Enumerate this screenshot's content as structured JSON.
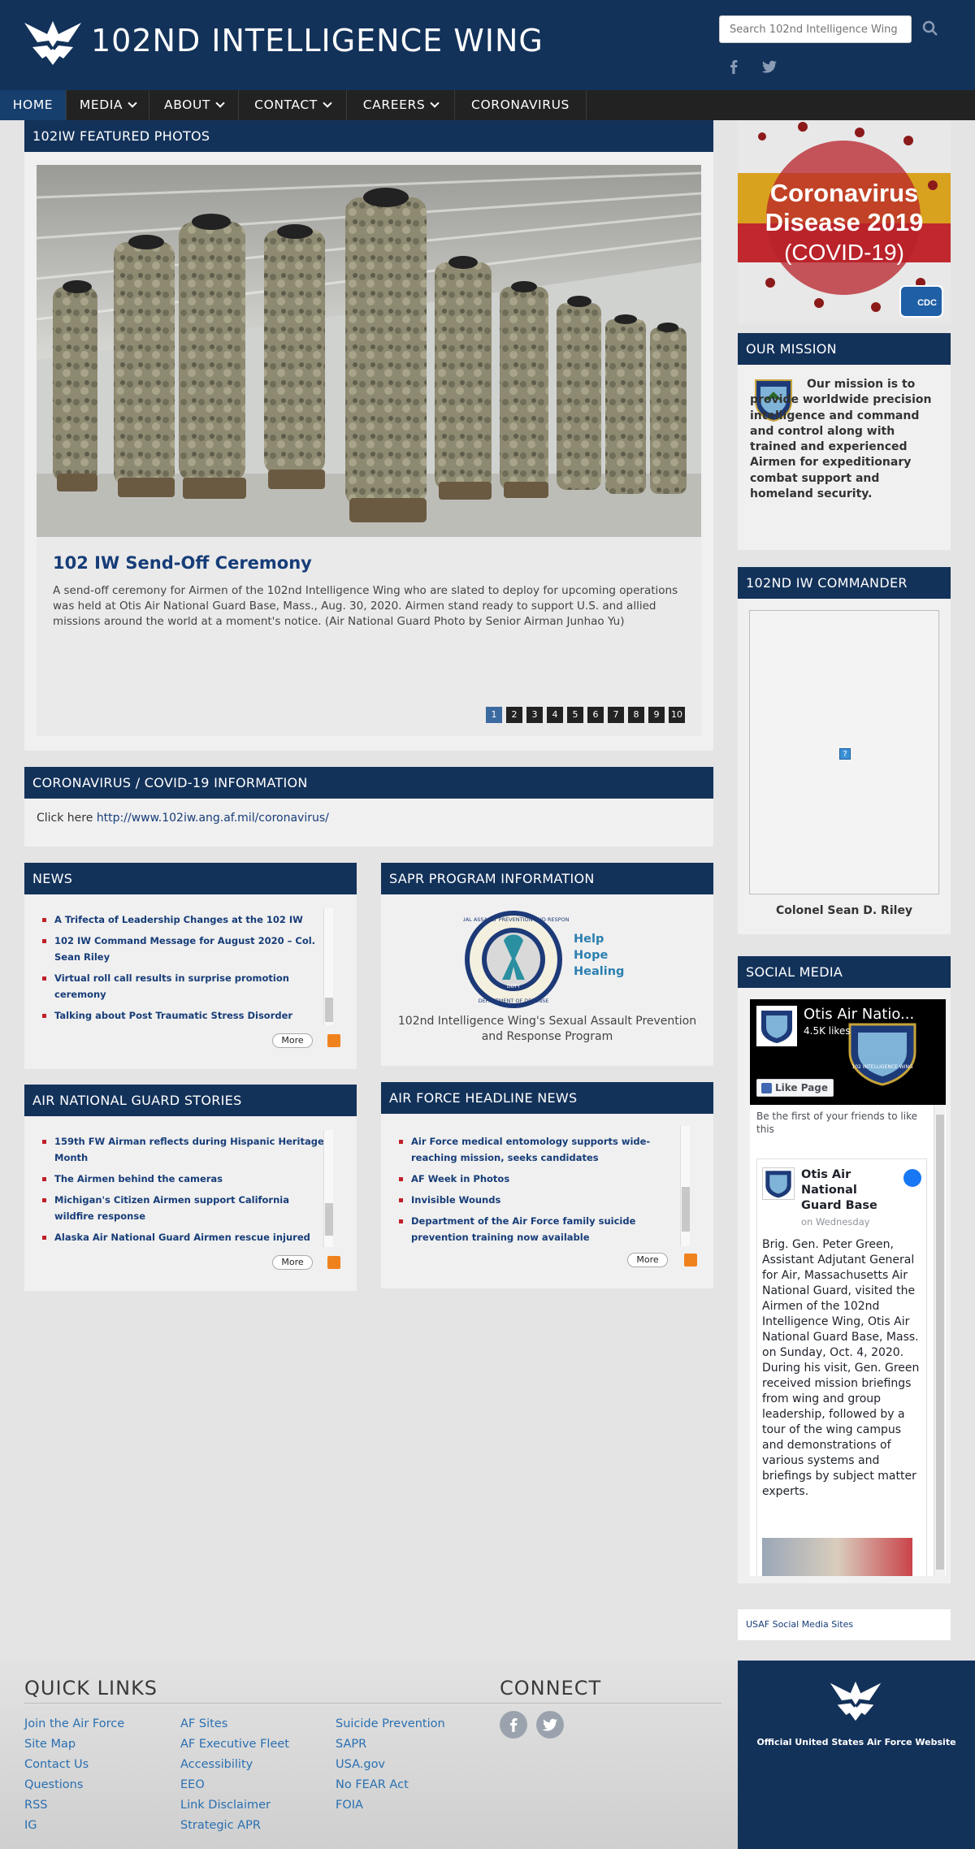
{
  "header": {
    "site_title": "102ND INTELLIGENCE WING",
    "search_placeholder": "Search 102nd Intelligence Wing"
  },
  "nav": {
    "items": [
      {
        "label": "HOME"
      },
      {
        "label": "MEDIA"
      },
      {
        "label": "ABOUT"
      },
      {
        "label": "CONTACT"
      },
      {
        "label": "CAREERS"
      },
      {
        "label": "CORONAVIRUS"
      }
    ]
  },
  "featured": {
    "heading": "102IW FEATURED PHOTOS",
    "title": "102 IW Send-Off Ceremony",
    "description": "A send-off ceremony for Airmen of the 102nd Intelligence Wing who are slated to deploy for upcoming operations was held at Otis Air National Guard Base, Mass., Aug. 30, 2020. Airmen stand ready to support U.S. and allied missions around the world at a moment's notice. (Air National Guard Photo by Senior Airman Junhao Yu)",
    "pages": [
      "1",
      "2",
      "3",
      "4",
      "5",
      "6",
      "7",
      "8",
      "9",
      "10"
    ],
    "active_page": "1"
  },
  "covid": {
    "heading": "CORONAVIRUS / COVID-19 INFORMATION",
    "lead": "Click here",
    "link": "http://www.102iw.ang.af.mil/coronavirus/"
  },
  "covid_banner": {
    "line1": "Coronavirus",
    "line2": "Disease 2019",
    "line3": "(COVID-19)",
    "badge": "CDC"
  },
  "news": {
    "heading": "NEWS",
    "items": [
      "A Trifecta of Leadership Changes at the 102 IW",
      "102 IW Command Message for August 2020 – Col. Sean Riley",
      "Virtual roll call results in surprise promotion ceremony",
      "Talking about Post Traumatic Stress Disorder"
    ],
    "more": "More"
  },
  "sapr": {
    "heading": "SAPR PROGRAM INFORMATION",
    "seal_top": "SEXUAL ASSAULT PREVENTION AND RESPONSE",
    "seal_bottom": "DEPARTMENT OF DEFENSE",
    "seal_word": "DUTY",
    "tagline": [
      "Help",
      "Hope",
      "Healing"
    ],
    "caption": "102nd Intelligence Wing's Sexual Assault Prevention and Response Program"
  },
  "ang_stories": {
    "heading": "AIR NATIONAL GUARD STORIES",
    "items": [
      "159th FW Airman reflects during Hispanic Heritage Month",
      "The Airmen behind the cameras",
      "Michigan's Citizen Airmen support California wildfire response",
      "Alaska Air National Guard Airmen rescue injured"
    ],
    "more": "More"
  },
  "af_news": {
    "heading": "AIR FORCE HEADLINE NEWS",
    "items": [
      "Air Force medical entomology supports wide-reaching mission, seeks candidates",
      "AF Week in Photos",
      "Invisible Wounds",
      "Department of the Air Force family suicide prevention training now available"
    ],
    "more": "More"
  },
  "mission": {
    "heading": "OUR MISSION",
    "text": "Our mission is to provide worldwide precision intelligence and command and control along with trained and experienced Airmen for expeditionary combat support and homeland security."
  },
  "commander": {
    "heading": "102ND IW COMMANDER",
    "name": "Colonel Sean D. Riley",
    "placeholder": "?"
  },
  "social": {
    "heading": "SOCIAL MEDIA",
    "fb_page": "Otis Air Natio...",
    "fb_likes": "4.5K likes",
    "fb_like_btn": "Like Page",
    "fb_friends": "Be the first of your friends to like this",
    "post_author": "Otis Air National Guard Base",
    "post_time": "on Wednesday",
    "post_text": "Brig. Gen. Peter Green, Assistant Adjutant General for Air, Massachusetts Air National Guard, visited the Airmen of the 102nd Intelligence Wing, Otis Air National Guard Base, Mass. on Sunday, Oct. 4, 2020. During his visit, Gen. Green received mission briefings from wing and group leadership, followed by a tour of the wing campus and demonstrations of various systems and briefings by subject matter experts.",
    "cover_text": "102 INTELLIGENCE WING",
    "usaf_link": "USAF Social Media Sites"
  },
  "footer": {
    "quick_links_heading": "QUICK LINKS",
    "col1": [
      "Join the Air Force",
      "Site Map",
      "Contact Us",
      "Questions",
      "RSS",
      "IG"
    ],
    "col2": [
      "AF Sites",
      "AF Executive Fleet",
      "Accessibility",
      "EEO",
      "Link Disclaimer",
      "Strategic APR"
    ],
    "col3": [
      "Suicide Prevention",
      "SAPR",
      "USA.gov",
      "No FEAR Act",
      "FOIA"
    ],
    "connect_heading": "CONNECT",
    "official": "Official United States Air Force Website"
  },
  "colors": {
    "navy": "#13325a",
    "nav_bg": "#222222",
    "link": "#173d78",
    "bullet": "#c0202a",
    "active_page": "#3b6aa0"
  }
}
